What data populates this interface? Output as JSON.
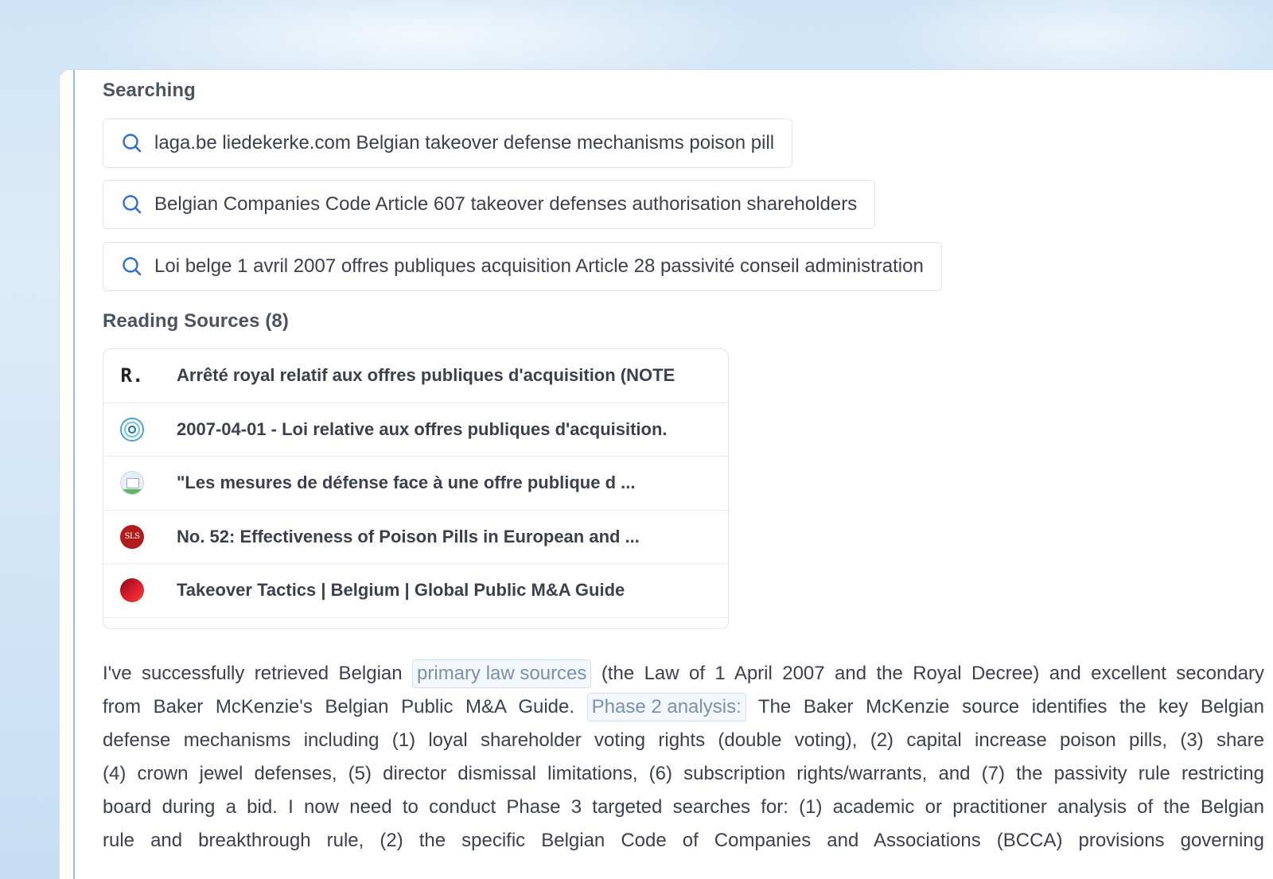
{
  "searching": {
    "title": "Searching",
    "queries": [
      "laga.be liedekerke.com Belgian takeover defense mechanisms poison pill",
      "Belgian Companies Code Article 607 takeover defenses authorisation shareholders",
      "Loi belge 1 avril 2007 offres publiques acquisition Article 28 passivité conseil administration"
    ],
    "icon": "search-icon"
  },
  "sources": {
    "title": "Reading Sources (8)",
    "items": [
      {
        "favicon": "R.",
        "icon": "letter-r-icon",
        "label": "Arrêté royal relatif aux offres publiques d'acquisition (NOTE"
      },
      {
        "icon": "target-icon",
        "label": "2007-04-01 - Loi relative aux offres publiques d'acquisition."
      },
      {
        "icon": "image-icon",
        "label": "\"Les mesures de défense face à une offre publique d ..."
      },
      {
        "favicon": "SLS",
        "icon": "sls-icon",
        "label": "No. 52: Effectiveness of Poison Pills in European and ..."
      },
      {
        "icon": "red-circle-icon",
        "label": "Takeover Tactics | Belgium | Global Public M&A Guide"
      }
    ]
  },
  "body": {
    "line1_a": "I've successfully retrieved Belgian",
    "chip1": "primary law sources",
    "line1_b": "(the Law of 1 April 2007 and the Royal Decree) and excellent secondary",
    "line2_a": "from Baker McKenzie's Belgian Public M&A Guide.",
    "chip2": "Phase 2 analysis:",
    "line2_b": "The Baker McKenzie source identifies the key Belgian",
    "line3": "defense mechanisms including (1) loyal shareholder voting rights (double voting), (2) capital increase poison pills, (3) share",
    "line4": "(4) crown jewel defenses, (5) director dismissal limitations, (6) subscription rights/warrants, and (7) the passivity rule restricting",
    "line5": "board during a bid. I now need to conduct Phase 3 targeted searches for: (1) academic or practitioner analysis of the Belgian",
    "line6": "rule and breakthrough rule, (2) the specific Belgian Code of Companies and Associations (BCCA) provisions governing"
  },
  "colors": {
    "accent": "#2f6fd6",
    "rail": "#8fb8ea",
    "chip_text": "#7c8fae"
  }
}
